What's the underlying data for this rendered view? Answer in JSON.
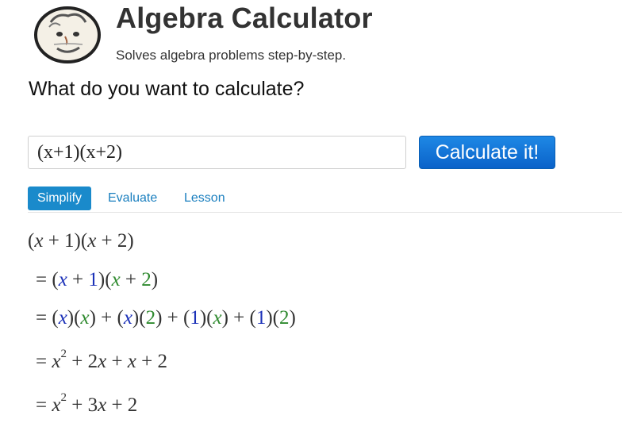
{
  "header": {
    "title": "Algebra Calculator",
    "subtitle": "Solves algebra problems step-by-step."
  },
  "prompt": {
    "question": "What do you want to calculate?"
  },
  "input": {
    "value": "(x+1)(x+2)"
  },
  "button": {
    "label": "Calculate it!"
  },
  "tabs": [
    {
      "label": "Simplify",
      "active": true
    },
    {
      "label": "Evaluate",
      "active": false
    },
    {
      "label": "Lesson",
      "active": false
    }
  ],
  "colors": {
    "first_factor_terms": "#1b31b8",
    "second_factor_terms": "#2f8a2f",
    "button": "#1a7fd6",
    "active_tab": "#1a8acb"
  },
  "steps": {
    "s0": {
      "a": "(",
      "x": "x",
      "b": " + 1)(",
      "x2": "x",
      "c": " + 2)"
    },
    "s1": {
      "eq": "= ",
      "p1": "(",
      "x": "x",
      "plus1": " + ",
      "one": "1",
      "mid": ")(",
      "x2": "x",
      "plus2": " + ",
      "two": "2",
      "end": ")"
    },
    "s2": {
      "eq": "= ",
      "o1": "(",
      "x1": "x",
      "c1": ")(",
      "x2": "x",
      "c2": ") + (",
      "x3": "x",
      "c3": ")(",
      "two1": "2",
      "c4": ") + (",
      "one1": "1",
      "c5": ")(",
      "x4": "x",
      "c6": ") + (",
      "one2": "1",
      "c7": ")(",
      "two2": "2",
      "c8": ")"
    },
    "s3": {
      "eq": "= ",
      "x": "x",
      "exp": "2",
      "t2": " + 2",
      "x2": "x",
      "t3": " + ",
      "x3": "x",
      "t4": " + 2"
    },
    "s4": {
      "eq": "= ",
      "x": "x",
      "exp": "2",
      "t2": " + 3",
      "x2": "x",
      "t3": " + 2"
    }
  }
}
